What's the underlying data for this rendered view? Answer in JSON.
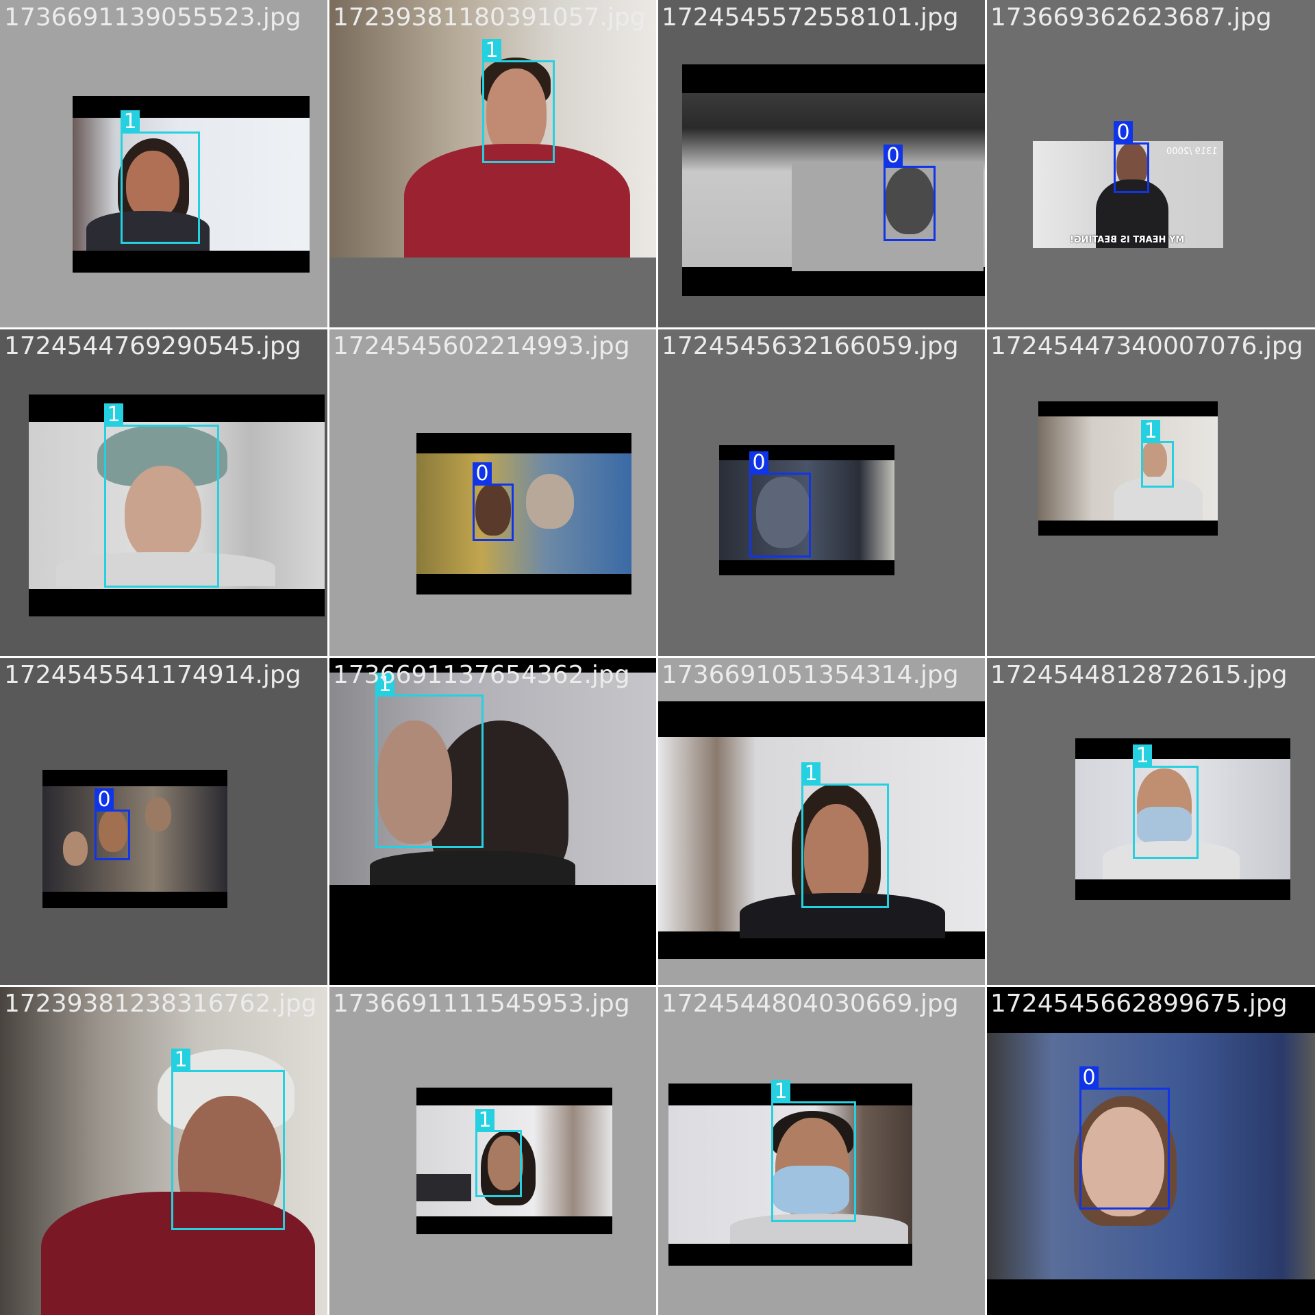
{
  "colors": {
    "class_1": "#25d0e0",
    "class_0": "#1035e8"
  },
  "tiles": [
    {
      "filename": "1736691139055523.jpg",
      "label": "1"
    },
    {
      "filename": "1723938118039105​7.jpg",
      "label": "1"
    },
    {
      "filename": "1724545572558101.jpg",
      "label": "0"
    },
    {
      "filename": "1736693626236​87.jpg",
      "label": "0"
    },
    {
      "filename": "1724544769290545.jpg",
      "label": "1"
    },
    {
      "filename": "1724545602214993.jpg",
      "label": "0"
    },
    {
      "filename": "1724545632166059.jpg",
      "label": "0"
    },
    {
      "filename": "17245447340007076.jpg",
      "label": "1"
    },
    {
      "filename": "1724545541174914.jpg",
      "label": "0"
    },
    {
      "filename": "1736691137654362.jpg",
      "label": "1"
    },
    {
      "filename": "1736691051354314.jpg",
      "label": "1"
    },
    {
      "filename": "1724544812872615.jpg",
      "label": "1"
    },
    {
      "filename": "1723938123831676​2.jpg",
      "label": "1"
    },
    {
      "filename": "1736691111545953.jpg",
      "label": "1"
    },
    {
      "filename": "1724544804030669.jpg",
      "label": "1"
    },
    {
      "filename": "1724545662899675.jpg",
      "label": "0"
    }
  ],
  "overlay_text": {
    "tile_3_top": "1319 /2000",
    "tile_3_bottom": "MY HEART IS BEATING!"
  }
}
